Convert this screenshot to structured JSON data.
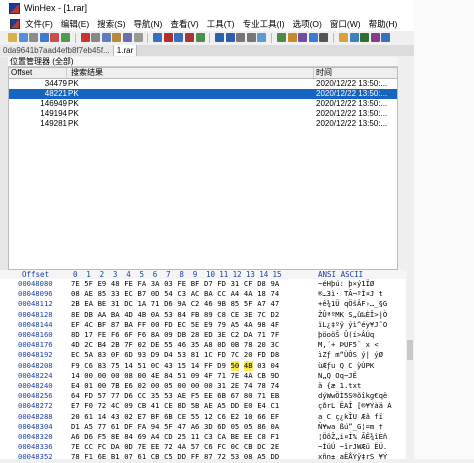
{
  "window": {
    "title": "WinHex - [1.rar]"
  },
  "menu": [
    "文件(F)",
    "编辑(E)",
    "搜索(S)",
    "导航(N)",
    "查看(V)",
    "工具(T)",
    "专业工具(I)",
    "选项(O)",
    "窗口(W)",
    "帮助(H)"
  ],
  "tabs": [
    "0da9641b7aad4efb8f7eb45f...",
    "1.rar"
  ],
  "panel": {
    "title": "位置管理器 (全部)"
  },
  "list": {
    "columns": [
      "Offset",
      "搜索结果",
      "时间"
    ],
    "rows": [
      {
        "offset": "34479",
        "result": "PK",
        "time": "2020/12/22  13:50:..."
      },
      {
        "offset": "48221",
        "result": "PK",
        "time": "2020/12/22  13:50:..."
      },
      {
        "offset": "146949",
        "result": "PK",
        "time": "2020/12/22  13:50:..."
      },
      {
        "offset": "149194",
        "result": "PK",
        "time": "2020/12/22  13:50:..."
      },
      {
        "offset": "149281",
        "result": "PK",
        "time": "2020/12/22  13:50:..."
      }
    ],
    "selected_index": 1
  },
  "hex": {
    "offset_label": "Offset",
    "columns": [
      "0",
      "1",
      "2",
      "3",
      "4",
      "5",
      "6",
      "7",
      "8",
      "9",
      "10",
      "11",
      "12",
      "13",
      "14",
      "15"
    ],
    "ascii_label": "ANSI ASCII",
    "rows": [
      {
        "offset": "00048080",
        "bytes": [
          "7E",
          "5F",
          "E9",
          "48",
          "FE",
          "FA",
          "3A",
          "03",
          "FE",
          "BF",
          "D7",
          "FD",
          "31",
          "CF",
          "D8",
          "9A"
        ],
        "ascii": "~éHþú: þ×ý1ÏØ"
      },
      {
        "offset": "00048096",
        "bytes": [
          "08",
          "AE",
          "85",
          "33",
          "EC",
          "B7",
          "0D",
          "54",
          "C3",
          "AC",
          "BA",
          "CC",
          "A4",
          "4A",
          "18",
          "74"
        ],
        "ascii": "®…3ì·  TÃ¬ºÌ¤J t"
      },
      {
        "offset": "00048112",
        "bytes": [
          "2B",
          "EA",
          "BE",
          "31",
          "DC",
          "1A",
          "71",
          "D6",
          "9A",
          "C2",
          "46",
          "9B",
          "85",
          "5F",
          "A7",
          "47"
        ],
        "ascii": "+ê¾1Ü qÖšÂF›…_§G"
      },
      {
        "offset": "00048128",
        "bytes": [
          "8E",
          "DB",
          "AA",
          "BA",
          "4D",
          "4B",
          "0A",
          "53",
          "84",
          "FB",
          "89",
          "C8",
          "CE",
          "3E",
          "7C",
          "D2"
        ],
        "ascii": "ŽÛªºMK S„û‰ÈÎ>|Ò"
      },
      {
        "offset": "00048144",
        "bytes": [
          "EF",
          "4C",
          "BF",
          "87",
          "BA",
          "FF",
          "00",
          "FD",
          "EC",
          "5E",
          "E9",
          "79",
          "A5",
          "4A",
          "98",
          "4F"
        ],
        "ascii": "ïL¿‡ºÿ ýì^éy¥J˜O"
      },
      {
        "offset": "00048160",
        "bytes": [
          "8D",
          "17",
          "FE",
          "F6",
          "6F",
          "F6",
          "8A",
          "09",
          "DB",
          "28",
          "ED",
          "3E",
          "C2",
          "DA",
          "71",
          "7F"
        ],
        "ascii": " þöoöŠ Û(í>ÂÚq"
      },
      {
        "offset": "00048176",
        "bytes": [
          "4D",
          "2C",
          "B4",
          "2B",
          "7F",
          "02",
          "DE",
          "55",
          "46",
          "35",
          "A8",
          "0D",
          "0B",
          "78",
          "20",
          "3C"
        ],
        "ascii": "M,´+ ÞUF5¨  x <"
      },
      {
        "offset": "00048192",
        "bytes": [
          "EC",
          "5A",
          "83",
          "0F",
          "6D",
          "93",
          "D9",
          "D4",
          "53",
          "81",
          "1C",
          "FD",
          "7C",
          "20",
          "FD",
          "D8"
        ],
        "ascii": "ìZƒ m“ÙÔS  ý| ýØ"
      },
      {
        "offset": "00048208",
        "bytes": [
          "F9",
          "C6",
          "83",
          "75",
          "14",
          "51",
          "0C",
          "43",
          "15",
          "14",
          "FF",
          "D9",
          "50",
          "4B",
          "03",
          "04"
        ],
        "ascii": "ùÆƒu Q C  ÿÙPK"
      },
      {
        "offset": "00048224",
        "bytes": [
          "14",
          "00",
          "00",
          "00",
          "08",
          "00",
          "4E",
          "84",
          "51",
          "09",
          "4F",
          "71",
          "7E",
          "4A",
          "CB",
          "9D"
        ],
        "ascii": "      N„Q Oq~JË"
      },
      {
        "offset": "00048240",
        "bytes": [
          "E4",
          "01",
          "00",
          "7B",
          "E6",
          "02",
          "00",
          "05",
          "00",
          "00",
          "00",
          "31",
          "2E",
          "74",
          "78",
          "74"
        ],
        "ascii": "ä  {æ      1.txt"
      },
      {
        "offset": "00048256",
        "bytes": [
          "64",
          "FD",
          "57",
          "77",
          "D6",
          "CC",
          "35",
          "53",
          "AE",
          "F5",
          "EE",
          "6B",
          "67",
          "80",
          "71",
          "EB"
        ],
        "ascii": "dýWwÖÌ5S®õîkg€që"
      },
      {
        "offset": "00048272",
        "bytes": [
          "E7",
          "F0",
          "72",
          "4C",
          "09",
          "CB",
          "41",
          "CE",
          "8D",
          "5B",
          "AE",
          "A5",
          "DD",
          "E0",
          "E4",
          "C1"
        ],
        "ascii": "çðrL ËAÎ [®¥Ýàä Á"
      },
      {
        "offset": "00048288",
        "bytes": [
          "20",
          "61",
          "14",
          "43",
          "02",
          "E7",
          "BF",
          "6B",
          "CE",
          "55",
          "12",
          "C6",
          "E2",
          "10",
          "66",
          "EF"
        ],
        "ascii": " a C ç¿kÎU Æâ fï"
      },
      {
        "offset": "00048304",
        "bytes": [
          "D1",
          "A5",
          "77",
          "61",
          "DF",
          "FA",
          "94",
          "5F",
          "47",
          "A6",
          "3D",
          "6D",
          "05",
          "05",
          "86",
          "0A"
        ],
        "ascii": "Ñ¥wa ßú”_G¦=m  †"
      },
      {
        "offset": "00048320",
        "bytes": [
          "A6",
          "D6",
          "F5",
          "8E",
          "84",
          "69",
          "A4",
          "CD",
          "25",
          "11",
          "C3",
          "CA",
          "BE",
          "EE",
          "C8",
          "F1"
        ],
        "ascii": "¦ÖõŽ„i¤Í% ÃÊ¾îÈñ"
      },
      {
        "offset": "00048336",
        "bytes": [
          "7E",
          "CC",
          "FC",
          "DA",
          "0D",
          "7E",
          "EE",
          "72",
          "4A",
          "57",
          "C6",
          "FC",
          "0C",
          "CB",
          "DC",
          "2E"
        ],
        "ascii": "~ÌüÚ ~îrJWÆü ËÜ."
      },
      {
        "offset": "00048352",
        "bytes": [
          "78",
          "F1",
          "6E",
          "B1",
          "07",
          "61",
          "CB",
          "C5",
          "DD",
          "FF",
          "87",
          "72",
          "53",
          "08",
          "A5",
          "DD"
        ],
        "ascii": "xñn± aËÅÝÿ‡rS ¥Ý"
      }
    ],
    "highlight": {
      "row": 8,
      "from": 12,
      "to": 13
    }
  },
  "colors": {
    "accent": "#1565c0",
    "highlight": "#ffe94d",
    "offset_blue": "#1a3fa8"
  }
}
